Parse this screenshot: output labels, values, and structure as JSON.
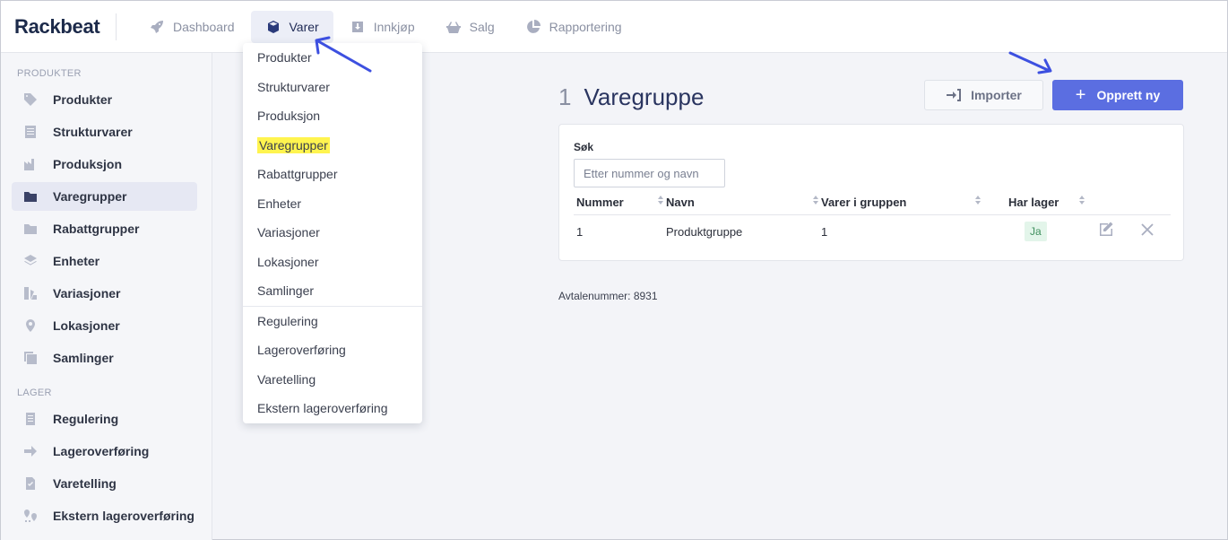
{
  "app": {
    "logo": "Rackbeat"
  },
  "topnav": [
    {
      "label": "Dashboard",
      "icon": "rocket-icon"
    },
    {
      "label": "Varer",
      "icon": "box-icon",
      "active": true
    },
    {
      "label": "Innkjøp",
      "icon": "download-icon"
    },
    {
      "label": "Salg",
      "icon": "basket-icon"
    },
    {
      "label": "Rapportering",
      "icon": "pie-chart-icon"
    }
  ],
  "sidebar": {
    "section_products": "PRODUKTER",
    "products": [
      {
        "label": "Produkter",
        "icon": "tag-icon"
      },
      {
        "label": "Strukturvarer",
        "icon": "list-icon"
      },
      {
        "label": "Produksjon",
        "icon": "factory-icon"
      },
      {
        "label": "Varegrupper",
        "icon": "folder-icon",
        "active": true
      },
      {
        "label": "Rabattgrupper",
        "icon": "folder-icon"
      },
      {
        "label": "Enheter",
        "icon": "layers-icon"
      },
      {
        "label": "Variasjoner",
        "icon": "variations-icon"
      },
      {
        "label": "Lokasjoner",
        "icon": "map-pin-icon"
      },
      {
        "label": "Samlinger",
        "icon": "collection-icon"
      }
    ],
    "section_stock": "LAGER",
    "stock": [
      {
        "label": "Regulering",
        "icon": "document-icon"
      },
      {
        "label": "Lageroverføring",
        "icon": "arrow-right-icon"
      },
      {
        "label": "Varetelling",
        "icon": "checklist-icon"
      },
      {
        "label": "Ekstern lageroverføring",
        "icon": "pins-icon"
      }
    ]
  },
  "dropdown": {
    "group1": [
      "Produkter",
      "Strukturvarer",
      "Produksjon",
      "Varegrupper",
      "Rabattgrupper",
      "Enheter",
      "Variasjoner",
      "Lokasjoner",
      "Samlinger"
    ],
    "group2": [
      "Regulering",
      "Lageroverføring",
      "Varetelling",
      "Ekstern lageroverføring"
    ],
    "highlighted": "Varegrupper"
  },
  "main": {
    "count": "1",
    "title": "Varegruppe",
    "import_label": "Importer",
    "create_label": "Opprett ny",
    "search_label": "Søk",
    "search_placeholder": "Etter nummer og navn",
    "columns": [
      "Nummer",
      "Navn",
      "Varer i gruppen",
      "Har lager"
    ],
    "rows": [
      {
        "nummer": "1",
        "navn": "Produktgruppe",
        "varer": "1",
        "har_lager": "Ja"
      }
    ],
    "footer": "Avtalenummer: 8931"
  },
  "colors": {
    "primary": "#5b6ee1",
    "highlight": "#fff44f",
    "arrow": "#3d50e0"
  }
}
